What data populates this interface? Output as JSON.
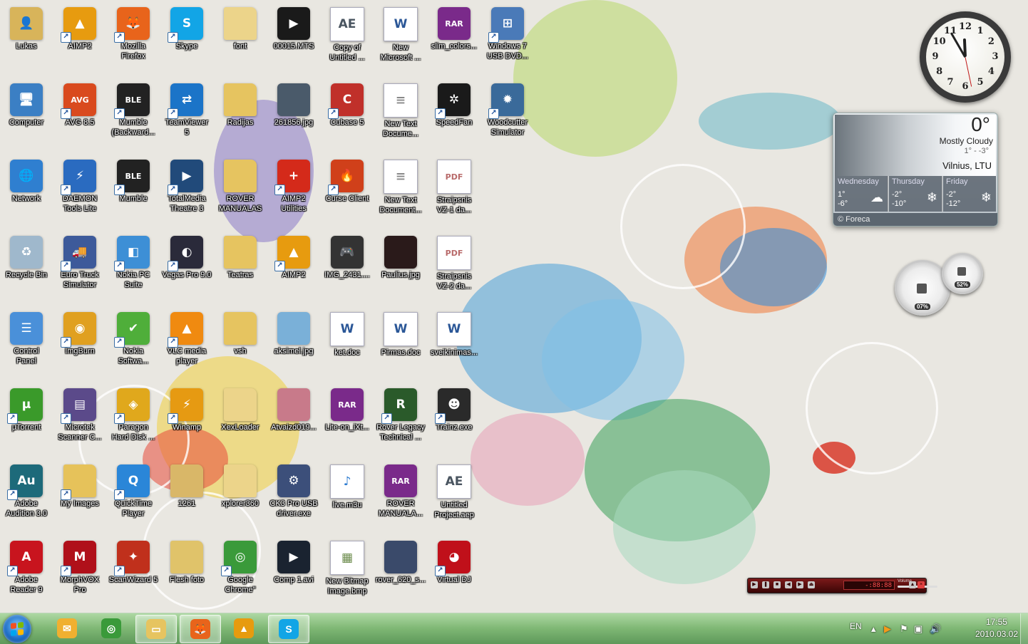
{
  "desktop": {
    "icons": [
      {
        "label": "Lukas",
        "icon": "user-folder-icon",
        "color": "#d8b45a",
        "kind": "folder",
        "glyph": "👤",
        "shortcut": false
      },
      {
        "label": "Computer",
        "icon": "computer-icon",
        "color": "#3b7fc4",
        "kind": "app",
        "glyph": "🖥",
        "shortcut": false
      },
      {
        "label": "Network",
        "icon": "network-icon",
        "color": "#2f7fd0",
        "kind": "app",
        "glyph": "🌐",
        "shortcut": false
      },
      {
        "label": "Recycle Bin",
        "icon": "recycle-bin-icon",
        "color": "#9fb8cc",
        "kind": "app",
        "glyph": "♻",
        "shortcut": false
      },
      {
        "label": "Control\nPanel",
        "icon": "control-panel-icon",
        "color": "#4a90d9",
        "kind": "app",
        "glyph": "☰",
        "shortcut": false
      },
      {
        "label": "µTorrent",
        "icon": "utorrent-icon",
        "color": "#3a9a2a",
        "kind": "app",
        "glyph": "µ",
        "shortcut": true
      },
      {
        "label": "Adobe\nAudition 3.0",
        "icon": "adobe-audition-icon",
        "color": "#1d6a7a",
        "kind": "app",
        "glyph": "Au",
        "shortcut": true
      },
      {
        "label": "Adobe\nReader 9",
        "icon": "adobe-reader-icon",
        "color": "#c8141e",
        "kind": "app",
        "glyph": "A",
        "shortcut": true
      },
      {
        "label": "AIMP2",
        "icon": "aimp2-icon",
        "color": "#e79b0f",
        "kind": "app",
        "glyph": "▲",
        "shortcut": true
      },
      {
        "label": "AVG 8.5",
        "icon": "avg-icon",
        "color": "#d94a1e",
        "kind": "app",
        "glyph": "AVG",
        "shortcut": true
      },
      {
        "label": "DAEMON\nTools Lite",
        "icon": "daemon-tools-icon",
        "color": "#2a6bc0",
        "kind": "app",
        "glyph": "⚡",
        "shortcut": true
      },
      {
        "label": "Euro Truck\nSimulator",
        "icon": "euro-truck-icon",
        "color": "#3d5a9a",
        "kind": "app",
        "glyph": "🚚",
        "shortcut": true
      },
      {
        "label": "ImgBurn",
        "icon": "imgburn-icon",
        "color": "#e0a020",
        "kind": "app",
        "glyph": "◉",
        "shortcut": true
      },
      {
        "label": "Microtek\nScanner C...",
        "icon": "scanner-icon",
        "color": "#5b4a8a",
        "kind": "app",
        "glyph": "▤",
        "shortcut": true
      },
      {
        "label": "My Images",
        "icon": "folder-icon",
        "color": "#e6c25a",
        "kind": "folder",
        "glyph": "",
        "shortcut": true
      },
      {
        "label": "MorphVOX\nPro",
        "icon": "morphvox-icon",
        "color": "#b0101a",
        "kind": "app",
        "glyph": "M",
        "shortcut": true
      },
      {
        "label": "Mozilla\nFirefox",
        "icon": "firefox-icon",
        "color": "#e8641b",
        "kind": "app",
        "glyph": "🦊",
        "shortcut": true
      },
      {
        "label": "Mumble\n(Backward...",
        "icon": "mumble-icon",
        "color": "#222222",
        "kind": "app",
        "glyph": "BLE",
        "shortcut": true
      },
      {
        "label": "Mumble",
        "icon": "mumble-icon",
        "color": "#222222",
        "kind": "app",
        "glyph": "BLE",
        "shortcut": true
      },
      {
        "label": "Nokia PC\nSuite",
        "icon": "nokia-pc-suite-icon",
        "color": "#3d8fd6",
        "kind": "app",
        "glyph": "◧",
        "shortcut": true
      },
      {
        "label": "Nokia\nSoftwa...",
        "icon": "nokia-software-icon",
        "color": "#4fae3a",
        "kind": "app",
        "glyph": "✔",
        "shortcut": true
      },
      {
        "label": "Paragon\nHard Disk ...",
        "icon": "paragon-icon",
        "color": "#e0a81c",
        "kind": "app",
        "glyph": "◈",
        "shortcut": true
      },
      {
        "label": "QuickTime\nPlayer",
        "icon": "quicktime-icon",
        "color": "#2a86d8",
        "kind": "app",
        "glyph": "Q",
        "shortcut": true
      },
      {
        "label": "ScanWizard 5",
        "icon": "scanwizard-icon",
        "color": "#c0301c",
        "kind": "app",
        "glyph": "✦",
        "shortcut": true
      },
      {
        "label": "Skype",
        "icon": "skype-icon",
        "color": "#12a5e6",
        "kind": "app",
        "glyph": "S",
        "shortcut": true
      },
      {
        "label": "TeamViewer\n5",
        "icon": "teamviewer-icon",
        "color": "#1b74c8",
        "kind": "app",
        "glyph": "⇄",
        "shortcut": true
      },
      {
        "label": "TotalMedia\nTheatre 3",
        "icon": "totalmedia-icon",
        "color": "#214a7a",
        "kind": "app",
        "glyph": "▶",
        "shortcut": true
      },
      {
        "label": "Vegas Pro 9.0",
        "icon": "vegas-pro-icon",
        "color": "#2a2a3a",
        "kind": "app",
        "glyph": "◐",
        "shortcut": true
      },
      {
        "label": "VLC media\nplayer",
        "icon": "vlc-icon",
        "color": "#f08a10",
        "kind": "app",
        "glyph": "▲",
        "shortcut": true
      },
      {
        "label": "Winamp",
        "icon": "winamp-icon",
        "color": "#e69a12",
        "kind": "app",
        "glyph": "⚡",
        "shortcut": true
      },
      {
        "label": "1261",
        "icon": "folder-icon",
        "color": "#d9b768",
        "kind": "folder",
        "glyph": "",
        "shortcut": false
      },
      {
        "label": "Flesh foto",
        "icon": "folder-icon",
        "color": "#e0c36a",
        "kind": "folder",
        "glyph": "",
        "shortcut": false
      },
      {
        "label": "font",
        "icon": "folder-icon",
        "color": "#ecd48a",
        "kind": "folder",
        "glyph": "",
        "shortcut": false
      },
      {
        "label": "Radijas",
        "icon": "folder-icon",
        "color": "#e6c460",
        "kind": "folder",
        "glyph": "",
        "shortcut": false
      },
      {
        "label": "ROVER\nMANUALAS",
        "icon": "folder-icon",
        "color": "#e6c460",
        "kind": "folder",
        "glyph": "",
        "shortcut": false
      },
      {
        "label": "Teatras",
        "icon": "folder-icon",
        "color": "#e6c460",
        "kind": "folder",
        "glyph": "",
        "shortcut": false
      },
      {
        "label": "vsh",
        "icon": "folder-icon",
        "color": "#e6c460",
        "kind": "folder",
        "glyph": "",
        "shortcut": false
      },
      {
        "label": "XexLoader",
        "icon": "folder-icon",
        "color": "#ecd48a",
        "kind": "folder",
        "glyph": "",
        "shortcut": false
      },
      {
        "label": "xplorer360",
        "icon": "folder-icon",
        "color": "#ecd48a",
        "kind": "folder",
        "glyph": "",
        "shortcut": false
      },
      {
        "label": "Google\nChrome\"",
        "icon": "chrome-icon",
        "color": "#3a9a3a",
        "kind": "app",
        "glyph": "◎",
        "shortcut": true
      },
      {
        "label": "00015.MTS",
        "icon": "video-file-icon",
        "color": "#1a1a1a",
        "kind": "app",
        "glyph": "▶",
        "shortcut": false
      },
      {
        "label": "261856.jpg",
        "icon": "image-file-icon",
        "color": "#4a5a6a",
        "kind": "app",
        "glyph": "",
        "shortcut": false
      },
      {
        "label": "AIMP2\nUtilities",
        "icon": "aimp2-utilities-icon",
        "color": "#d42a1a",
        "kind": "app",
        "glyph": "+",
        "shortcut": true
      },
      {
        "label": "AIMP2",
        "icon": "aimp2-icon",
        "color": "#e79b0f",
        "kind": "app",
        "glyph": "▲",
        "shortcut": true
      },
      {
        "label": "aksimel.jpg",
        "icon": "image-file-icon",
        "color": "#7ab0d8",
        "kind": "app",
        "glyph": "",
        "shortcut": false
      },
      {
        "label": "Atvaizd019...",
        "icon": "image-file-icon",
        "color": "#c87a8a",
        "kind": "app",
        "glyph": "",
        "shortcut": false
      },
      {
        "label": "CK3 Pro USB\ndriver.exe",
        "icon": "installer-icon",
        "color": "#3c4f7a",
        "kind": "app",
        "glyph": "⚙",
        "shortcut": false
      },
      {
        "label": "Comp 1.avi",
        "icon": "video-file-icon",
        "color": "#1a2330",
        "kind": "app",
        "glyph": "▶",
        "shortcut": false
      },
      {
        "label": "Copy of\nUntitled ...",
        "icon": "after-effects-file-icon",
        "color": "#4a5560",
        "kind": "doc",
        "glyph": "AE",
        "shortcut": false
      },
      {
        "label": "Cubase 5",
        "icon": "cubase-icon",
        "color": "#c0302a",
        "kind": "app",
        "glyph": "C",
        "shortcut": true
      },
      {
        "label": "Curse Client",
        "icon": "curse-client-icon",
        "color": "#d0401a",
        "kind": "app",
        "glyph": "🔥",
        "shortcut": true
      },
      {
        "label": "IMG_2431....",
        "icon": "gamepad-image-icon",
        "color": "#333333",
        "kind": "app",
        "glyph": "🎮",
        "shortcut": false
      },
      {
        "label": "ket.doc",
        "icon": "word-document-icon",
        "color": "#2b5797",
        "kind": "doc",
        "glyph": "W",
        "shortcut": false
      },
      {
        "label": "Lite-on_iXt...",
        "icon": "winrar-icon",
        "color": "#7a2a8a",
        "kind": "app",
        "glyph": "RAR",
        "shortcut": false
      },
      {
        "label": "live.m3u",
        "icon": "playlist-file-icon",
        "color": "#2a7ad0",
        "kind": "doc",
        "glyph": "♪",
        "shortcut": false
      },
      {
        "label": "New Bitmap\nImage.bmp",
        "icon": "bitmap-file-icon",
        "color": "#6a8a4a",
        "kind": "doc",
        "glyph": "▦",
        "shortcut": false
      },
      {
        "label": "New\nMicrosoft ...",
        "icon": "word-document-icon",
        "color": "#2b5797",
        "kind": "doc",
        "glyph": "W",
        "shortcut": false
      },
      {
        "label": "New Text\nDocume...",
        "icon": "text-document-icon",
        "color": "#888888",
        "kind": "doc",
        "glyph": "≡",
        "shortcut": false
      },
      {
        "label": "New Text\nDocument...",
        "icon": "text-document-icon",
        "color": "#888888",
        "kind": "doc",
        "glyph": "≡",
        "shortcut": false
      },
      {
        "label": "Paulius.jpg",
        "icon": "image-file-icon",
        "color": "#2a1a1a",
        "kind": "app",
        "glyph": "",
        "shortcut": false
      },
      {
        "label": "Pirmas.doc",
        "icon": "word-document-icon",
        "color": "#2b5797",
        "kind": "doc",
        "glyph": "W",
        "shortcut": false
      },
      {
        "label": "Rover Legacy\nTechnical ...",
        "icon": "rover-icon",
        "color": "#2a5a2a",
        "kind": "app",
        "glyph": "R",
        "shortcut": true
      },
      {
        "label": "ROVER\nMANUALA...",
        "icon": "winrar-icon",
        "color": "#7a2a8a",
        "kind": "app",
        "glyph": "RAR",
        "shortcut": false
      },
      {
        "label": "rover_620_s...",
        "icon": "image-file-icon",
        "color": "#3a4a6a",
        "kind": "app",
        "glyph": "",
        "shortcut": false
      },
      {
        "label": "slim_colors...",
        "icon": "winrar-icon",
        "color": "#7a2a8a",
        "kind": "app",
        "glyph": "RAR",
        "shortcut": false
      },
      {
        "label": "SpeedFan",
        "icon": "speedfan-icon",
        "color": "#1a1a1a",
        "kind": "app",
        "glyph": "✲",
        "shortcut": true
      },
      {
        "label": "Straipsnis\nVZ-1 da...",
        "icon": "pdf-file-icon",
        "color": "#b86a6a",
        "kind": "doc",
        "glyph": "PDF",
        "shortcut": false
      },
      {
        "label": "Straipsnis\nVZ-2 da...",
        "icon": "pdf-file-icon",
        "color": "#b86a6a",
        "kind": "doc",
        "glyph": "PDF",
        "shortcut": false
      },
      {
        "label": "sveikinimas...",
        "icon": "word-document-icon",
        "color": "#2b5797",
        "kind": "doc",
        "glyph": "W",
        "shortcut": false
      },
      {
        "label": "Trainz.exe",
        "icon": "trainz-icon",
        "color": "#2a2a2a",
        "kind": "app",
        "glyph": "☻",
        "shortcut": true
      },
      {
        "label": "Untitled\nProject.aep",
        "icon": "after-effects-file-icon",
        "color": "#4a5560",
        "kind": "doc",
        "glyph": "AE",
        "shortcut": false
      },
      {
        "label": "Virtual DJ",
        "icon": "virtual-dj-icon",
        "color": "#c0101a",
        "kind": "app",
        "glyph": "◕",
        "shortcut": true
      },
      {
        "label": "Windows 7\nUSB DVD...",
        "icon": "windows-installer-icon",
        "color": "#4a7ab8",
        "kind": "app",
        "glyph": "⊞",
        "shortcut": true
      },
      {
        "label": "Woodcutter\nSimulator",
        "icon": "saw-blade-icon",
        "color": "#3a6a9a",
        "kind": "app",
        "glyph": "✹",
        "shortcut": true
      }
    ]
  },
  "gadgets": {
    "clock": {
      "hour": 11,
      "minute": 55,
      "numbers": [
        "12",
        "1",
        "2",
        "3",
        "4",
        "5",
        "6",
        "7",
        "8",
        "9",
        "10",
        "11"
      ]
    },
    "weather": {
      "temperature": "0°",
      "condition": "Mostly Cloudy",
      "hi_lo": "1° - -3°",
      "location": "Vilnius, LTU",
      "forecast": [
        {
          "day": "Wednesday",
          "high": "1°",
          "low": "-6°",
          "symbol": "cloud-icon"
        },
        {
          "day": "Thursday",
          "high": "-2°",
          "low": "-10°",
          "symbol": "snow-icon"
        },
        {
          "day": "Friday",
          "high": "-2°",
          "low": "-12°",
          "symbol": "snow-icon"
        }
      ],
      "credit": "© Foreca"
    },
    "cpu_meter": {
      "cpu": "07%",
      "memory": "52%"
    },
    "media_player": {
      "time": "-:88:88",
      "volume_label": "Volume"
    }
  },
  "taskbar": {
    "pinned": [
      {
        "name": "outlook-icon",
        "color": "#f0b030",
        "glyph": "✉",
        "active": false
      },
      {
        "name": "chrome-icon",
        "color": "#3a9a3a",
        "glyph": "◎",
        "active": false
      },
      {
        "name": "explorer-icon",
        "color": "#e6c460",
        "glyph": "▭",
        "active": true
      },
      {
        "name": "firefox-icon",
        "color": "#e8641b",
        "glyph": "🦊",
        "active": true
      },
      {
        "name": "aimp2-icon",
        "color": "#e79b0f",
        "glyph": "▲",
        "active": false
      },
      {
        "name": "skype-icon",
        "color": "#12a5e6",
        "glyph": "S",
        "active": true
      }
    ],
    "tray": {
      "language": "EN",
      "time": "17:55",
      "date": "2010.03.02"
    }
  },
  "colors": {
    "taskbar": "#79b46f",
    "wallpaper": "#e9e7e1"
  }
}
